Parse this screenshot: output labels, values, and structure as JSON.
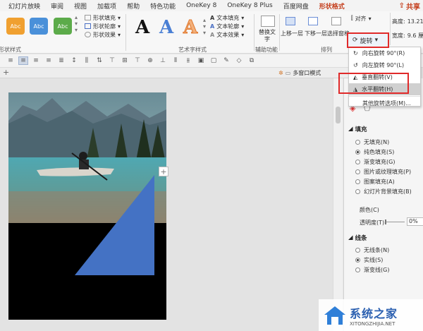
{
  "tabs": [
    "幻灯片放映",
    "审阅",
    "视图",
    "加载项",
    "帮助",
    "特色功能",
    "OneKey 8",
    "OneKey 8 Plus",
    "百度网盘",
    "形状格式"
  ],
  "share_label": "共享",
  "ribbon": {
    "shape_styles": [
      {
        "label": "Abc",
        "color": "#f0a030"
      },
      {
        "label": "Abc",
        "color": "#4a90d9"
      },
      {
        "label": "Abc",
        "color": "#5cab4a"
      }
    ],
    "shape_fill": "形状填充",
    "shape_outline": "形状轮廓",
    "shape_effects": "形状效果",
    "group_shape_styles": "形状样式",
    "wordart_letters": [
      "A",
      "A",
      "A"
    ],
    "text_fill": "文本填充",
    "text_outline": "文本轮廓",
    "text_effects": "文本效果",
    "group_wordart": "艺术字样式",
    "replace_text": "替换文字",
    "group_accessibility": "辅助功能",
    "bring_forward": "上移一层",
    "send_backward": "下移一层",
    "selection_pane": "选择窗格",
    "group_arrange": "排列",
    "align": "对齐",
    "height_label": "高度:",
    "height_value": "13.21",
    "width_label": "宽度:",
    "width_value": "9.6 厘"
  },
  "rotate": {
    "button_label": "旋转",
    "items": [
      "向右旋转 90°(R)",
      "向左旋转 90°(L)",
      "垂直翻转(V)",
      "水平翻转(H)",
      "其他旋转选项(M)..."
    ]
  },
  "multiwin_label": "多窗口模式",
  "pane": {
    "fill_header": "填充",
    "fill_options": [
      "无填充(N)",
      "纯色填充(S)",
      "渐变填充(G)",
      "图片或纹理填充(P)",
      "图案填充(A)",
      "幻灯片背景填充(B)"
    ],
    "color_label": "颜色(C)",
    "transparency_label": "透明度(T)",
    "transparency_value": "0%",
    "line_header": "线条",
    "line_options": [
      "无线条(N)",
      "实线(S)",
      "渐变线(G)"
    ]
  },
  "watermark": {
    "brand": "系统之家",
    "url": "XITONGZHIJIA.NET"
  },
  "colors": {
    "accent": "#c43e1c",
    "highlight_red": "#e02a2a",
    "triangle": "#4472c4"
  }
}
